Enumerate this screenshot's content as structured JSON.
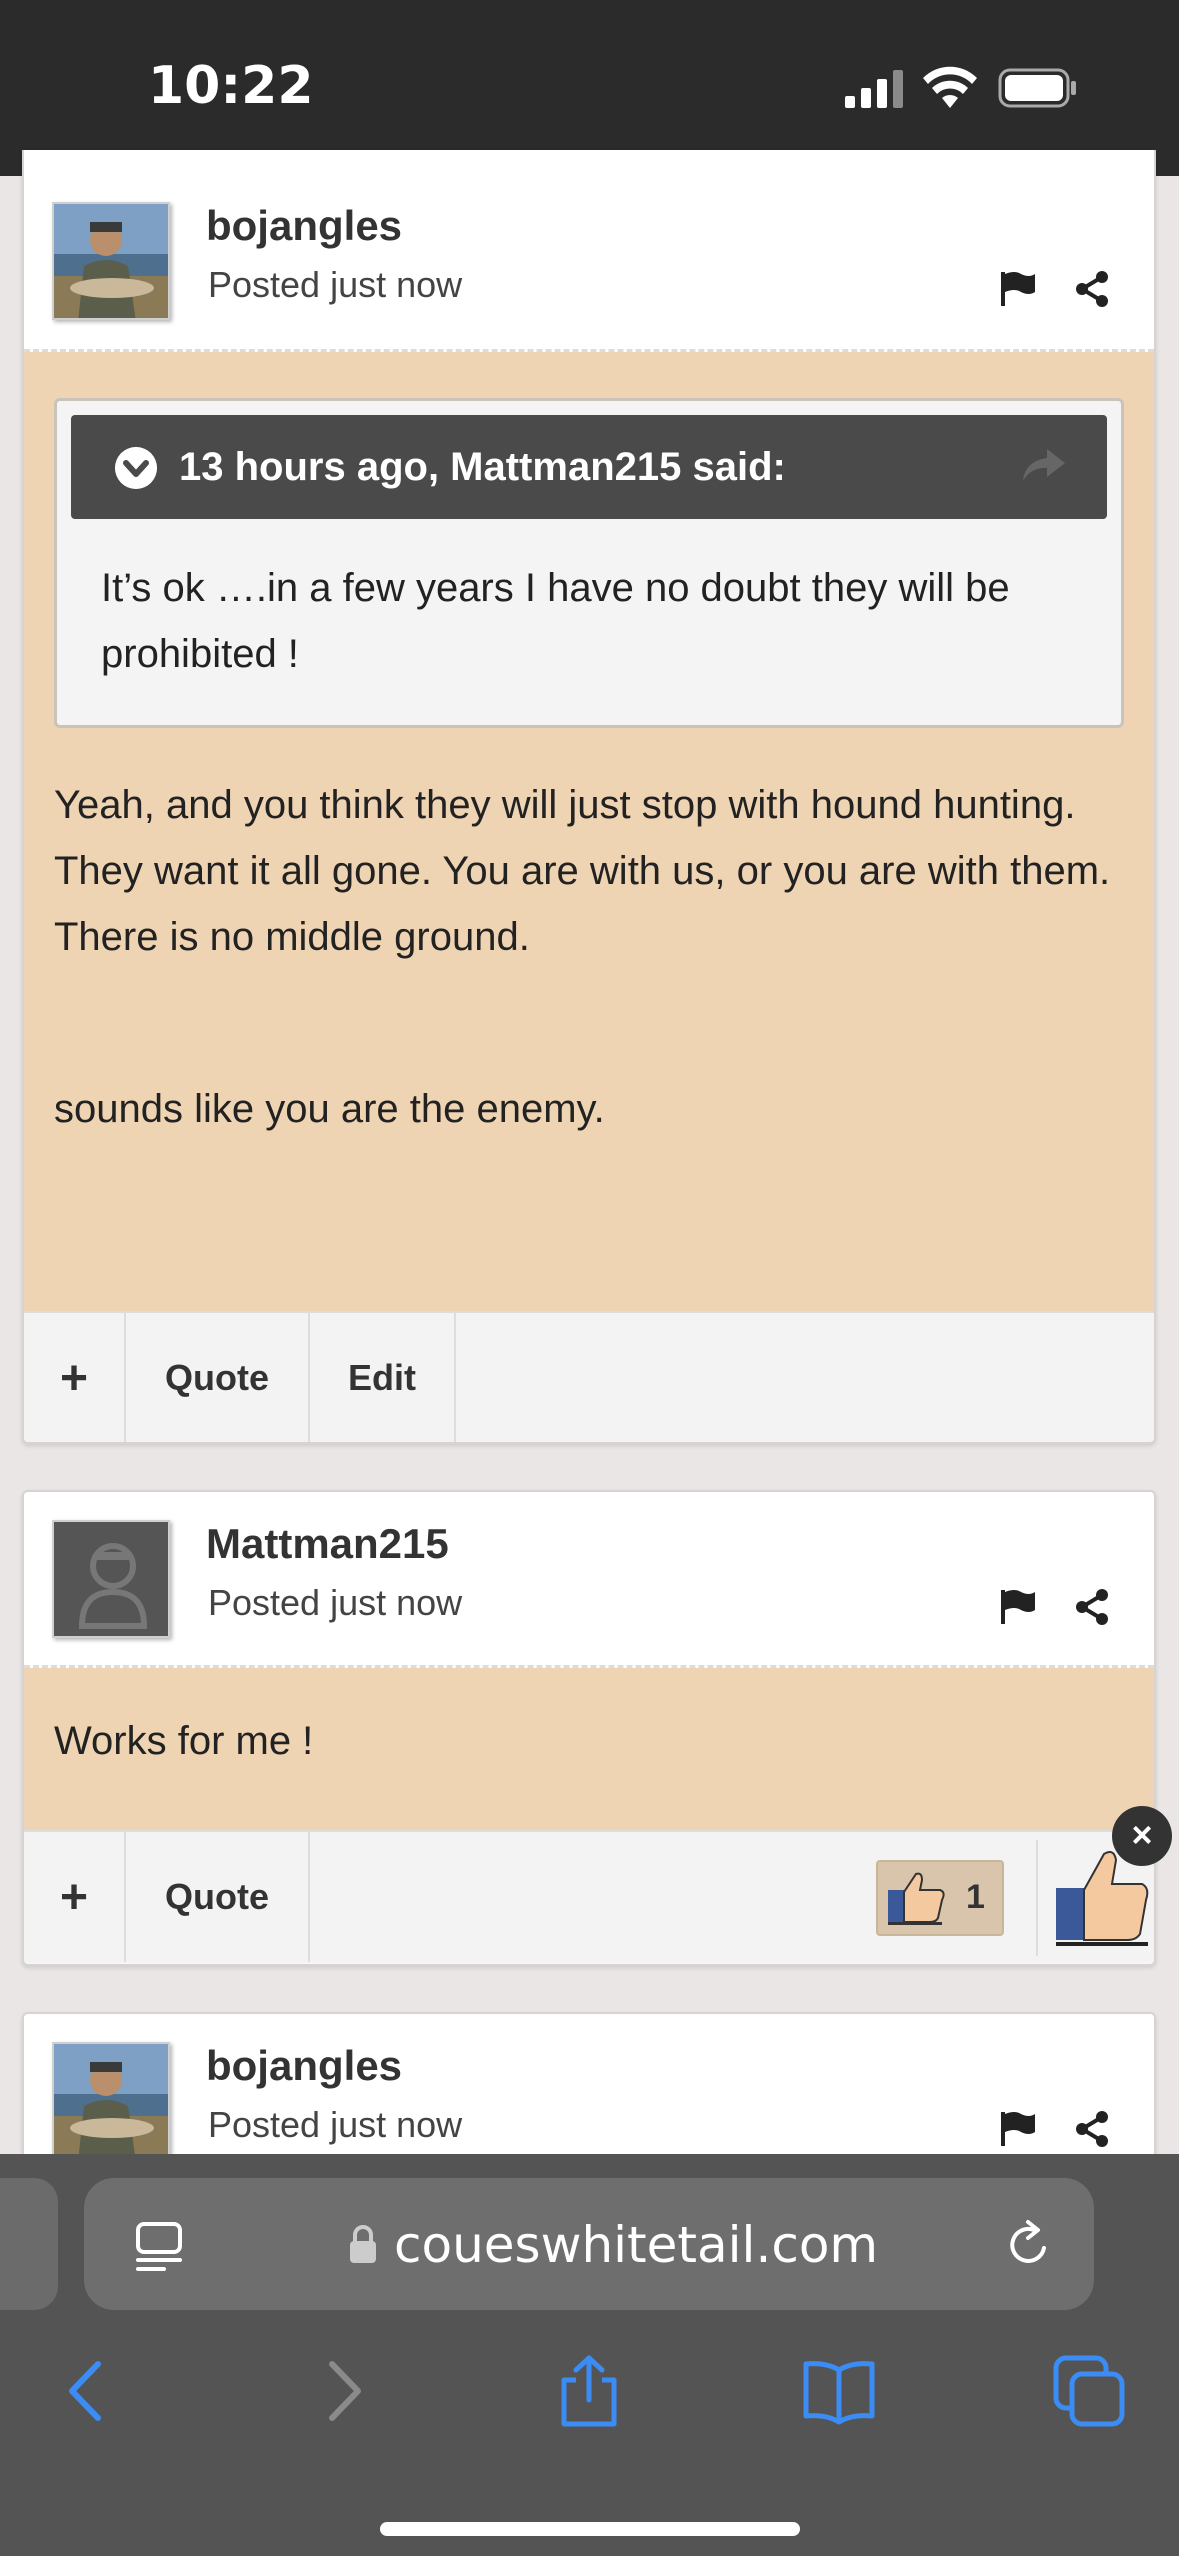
{
  "status_bar": {
    "time": "10:22"
  },
  "posts": [
    {
      "username": "bojangles",
      "posted": "Posted just now",
      "quote": {
        "header": "13 hours ago, Mattman215 said:",
        "text": "It’s ok ….in a few years I have no doubt they will be prohibited !"
      },
      "body": [
        "Yeah, and you think they will just stop with hound hunting.  They want it all gone.  You are with us, or you are with them.  There is no middle ground.",
        "sounds like you are the enemy."
      ],
      "footer": {
        "plus": "+",
        "quote": "Quote",
        "edit": "Edit"
      }
    },
    {
      "username": "Mattman215",
      "posted": "Posted just now",
      "body": [
        "Works for me !"
      ],
      "footer": {
        "plus": "+",
        "quote": "Quote"
      },
      "reaction": {
        "icon": "like-icon",
        "count": "1"
      }
    },
    {
      "username": "bojangles",
      "posted": "Posted just now"
    }
  ],
  "close_badge": "×",
  "browser": {
    "url": "coueswhitetail.com",
    "nav_icons": [
      "back-icon",
      "forward-icon",
      "share-icon",
      "bookmarks-icon",
      "tabs-icon"
    ]
  },
  "colors": {
    "post_body_bg": "#eed4b3",
    "quote_header_bg": "#4a4a4a",
    "ios_blue": "#3b8cf5"
  }
}
